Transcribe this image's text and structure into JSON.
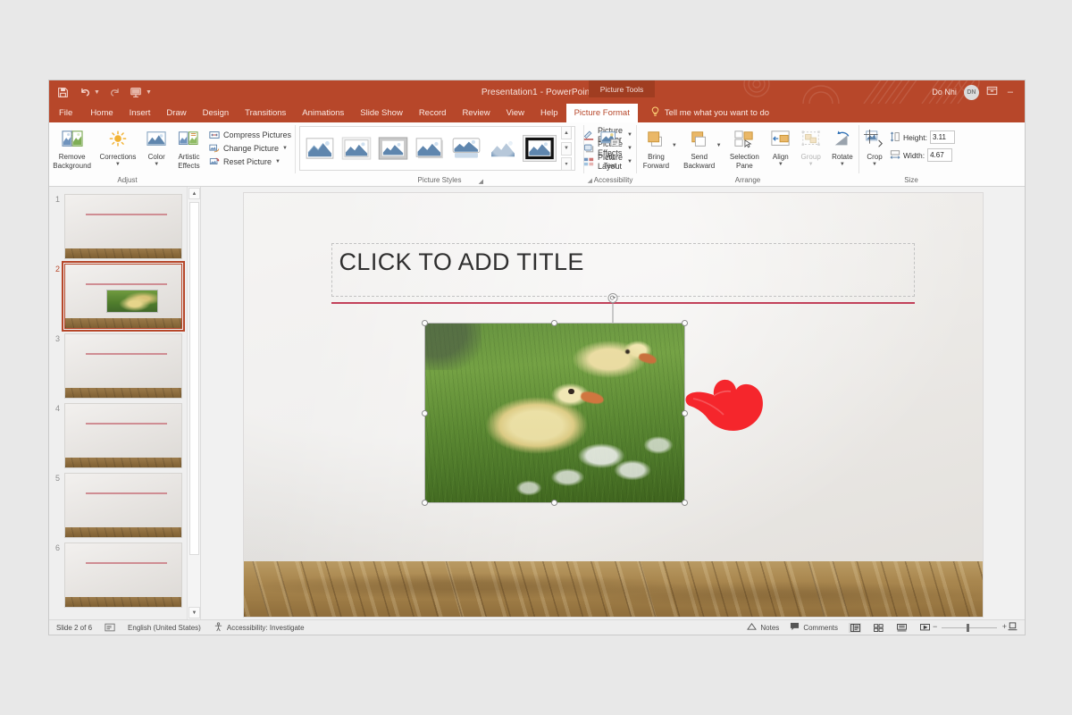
{
  "window": {
    "title": "Presentation1  -  PowerPoint",
    "contextual_tab_label": "Picture Tools",
    "user_name": "Do Nhi",
    "user_initials": "DN",
    "minimize_label": "–",
    "ribbon_display_icon": "ribbon-display-options-icon"
  },
  "quick_access": [
    {
      "name": "save-icon",
      "label": "Save"
    },
    {
      "name": "undo-icon",
      "label": "Undo"
    },
    {
      "name": "redo-icon",
      "label": "Redo"
    },
    {
      "name": "start-from-beginning-icon",
      "label": "Start From Beginning"
    },
    {
      "name": "customize-qat-icon",
      "label": "Customize Quick Access Toolbar"
    }
  ],
  "tabs": [
    {
      "label": "File",
      "active": false
    },
    {
      "label": "Home",
      "active": false
    },
    {
      "label": "Insert",
      "active": false
    },
    {
      "label": "Draw",
      "active": false
    },
    {
      "label": "Design",
      "active": false
    },
    {
      "label": "Transitions",
      "active": false
    },
    {
      "label": "Animations",
      "active": false
    },
    {
      "label": "Slide Show",
      "active": false
    },
    {
      "label": "Record",
      "active": false
    },
    {
      "label": "Review",
      "active": false
    },
    {
      "label": "View",
      "active": false
    },
    {
      "label": "Help",
      "active": false
    },
    {
      "label": "Picture Format",
      "active": true
    }
  ],
  "tell_me": {
    "placeholder": "Tell me what you want to do"
  },
  "ribbon": {
    "adjust": {
      "group_label": "Adjust",
      "remove_background": "Remove\nBackground",
      "remove_background_l1": "Remove",
      "remove_background_l2": "Background",
      "corrections": "Corrections",
      "color": "Color",
      "artistic_l1": "Artistic",
      "artistic_l2": "Effects",
      "compress_pictures": "Compress Pictures",
      "change_picture": "Change Picture",
      "reset_picture": "Reset Picture"
    },
    "picture_styles": {
      "group_label": "Picture Styles",
      "selected_index": 6,
      "items": [
        "Simple Frame, White",
        "Beveled Matte, White",
        "Metal Frame",
        "Drop Shadow Rectangle",
        "Reflected Rounded Rectangle",
        "Soft Edge Rectangle",
        "Simple Frame, Black"
      ],
      "picture_border": "Picture Border",
      "picture_effects": "Picture Effects",
      "picture_layout": "Picture Layout"
    },
    "accessibility": {
      "group_label": "Accessibility",
      "alt_text_l1": "Alt",
      "alt_text_l2": "Text"
    },
    "arrange": {
      "group_label": "Arrange",
      "bring_forward_l1": "Bring",
      "bring_forward_l2": "Forward",
      "send_backward_l1": "Send",
      "send_backward_l2": "Backward",
      "selection_pane_l1": "Selection",
      "selection_pane_l2": "Pane",
      "align": "Align",
      "group": "Group",
      "rotate": "Rotate"
    },
    "size": {
      "group_label": "Size",
      "crop": "Crop",
      "height_label": "Height:",
      "height_value": "3.11",
      "width_label": "Width:",
      "width_value": "4.67"
    }
  },
  "slides_pane": {
    "slides": [
      {
        "number": "1",
        "active": false,
        "has_picture": false
      },
      {
        "number": "2",
        "active": true,
        "has_picture": true
      },
      {
        "number": "3",
        "active": false,
        "has_picture": false
      },
      {
        "number": "4",
        "active": false,
        "has_picture": false
      },
      {
        "number": "5",
        "active": false,
        "has_picture": false
      },
      {
        "number": "6",
        "active": false,
        "has_picture": false
      }
    ]
  },
  "slide": {
    "title_placeholder": "CLICK TO ADD TITLE",
    "accent_color": "#c2415a",
    "picture": {
      "name": "goslings-in-grass-photo",
      "description": "Two yellow goslings in green grass with white clover flowers",
      "selected": true
    },
    "cursor": {
      "name": "red-hand-pointer",
      "color": "#f5262c"
    }
  },
  "status_bar": {
    "slide_counter": "Slide 2 of 6",
    "language": "English (United States)",
    "accessibility": "Accessibility: Investigate",
    "notes": "Notes",
    "comments": "Comments",
    "views": [
      {
        "name": "normal-view-button",
        "selected": true
      },
      {
        "name": "slide-sorter-view-button",
        "selected": false
      },
      {
        "name": "reading-view-button",
        "selected": false
      },
      {
        "name": "slide-show-button",
        "selected": false
      }
    ],
    "zoom_out": "−",
    "zoom_in": "+"
  }
}
